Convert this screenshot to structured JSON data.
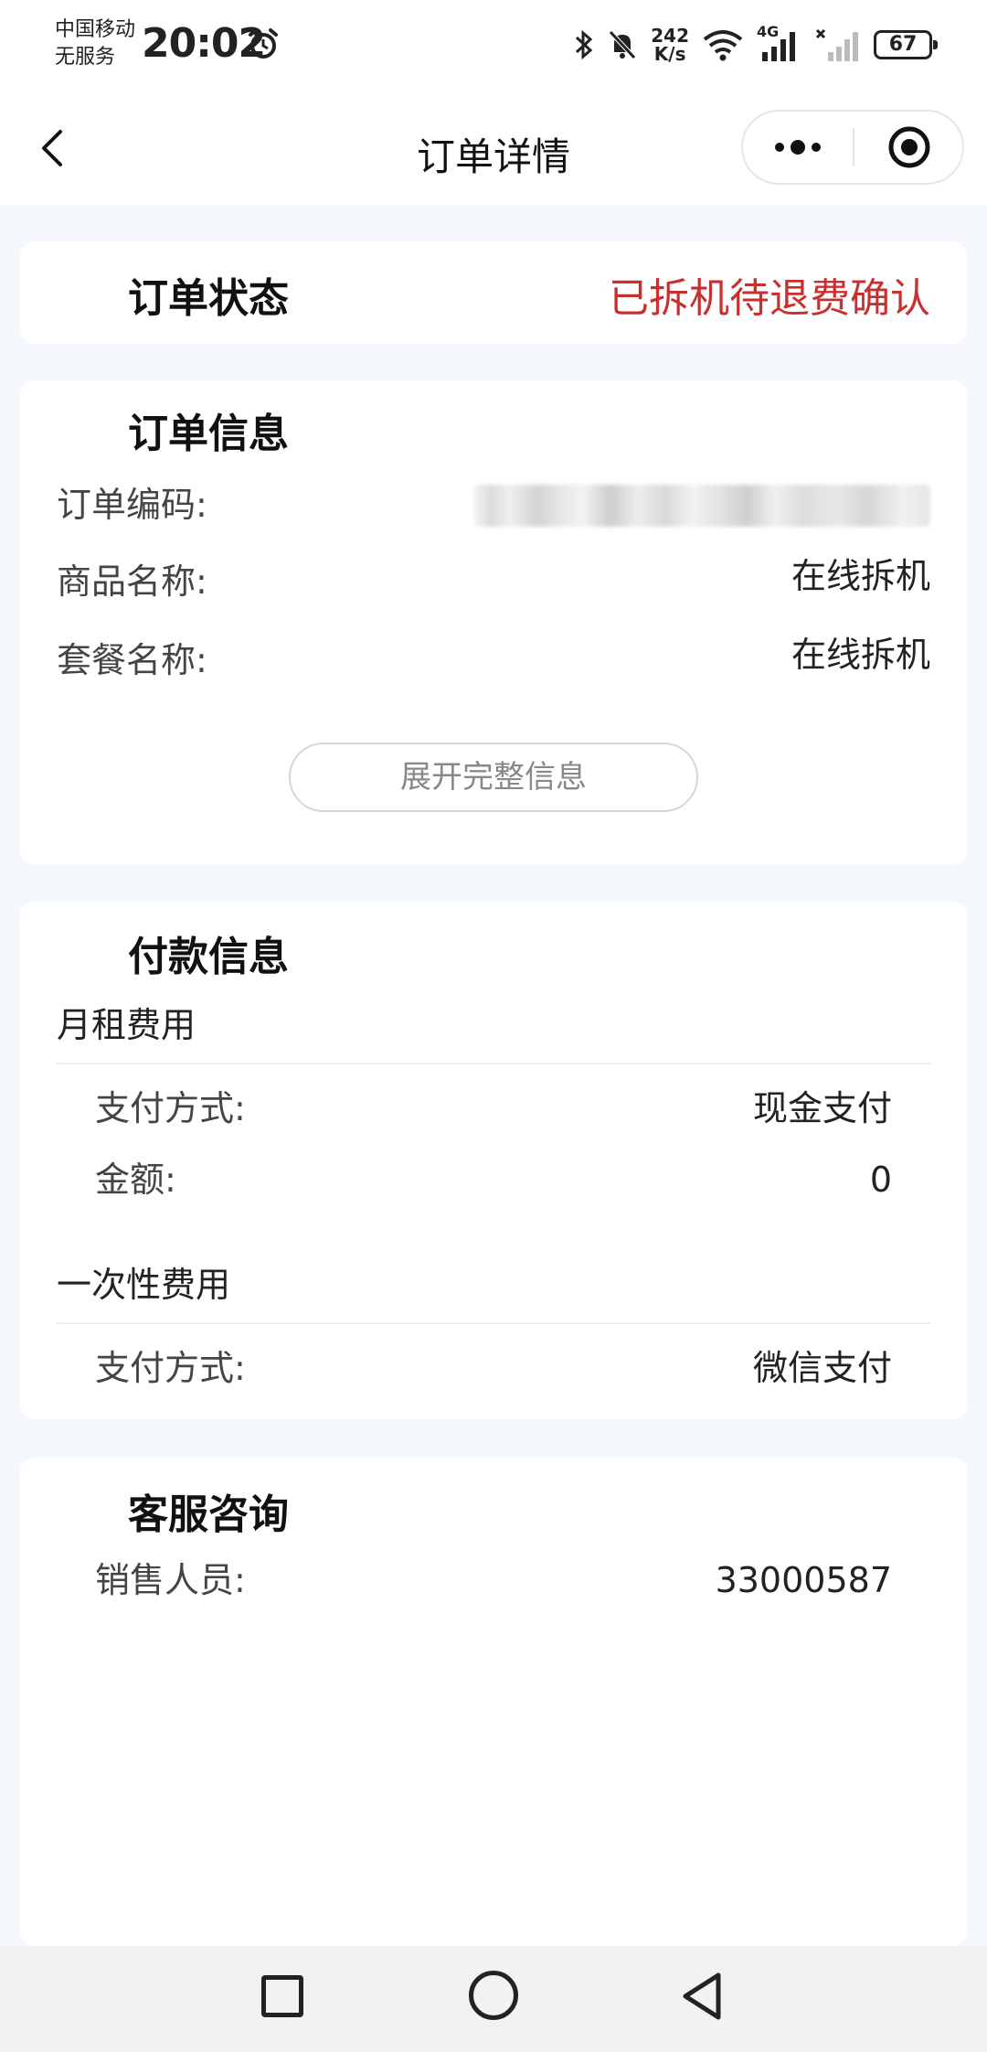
{
  "status_bar": {
    "carrier_line1": "中国移动",
    "carrier_line2": "无服务",
    "time": "20:02",
    "net_speed_value": "242",
    "net_speed_unit": "K/s",
    "network_type": "4G",
    "battery": "67"
  },
  "nav": {
    "title": "订单详情"
  },
  "order_status": {
    "label": "订单状态",
    "value": "已拆机待退费确认",
    "value_color": "#c8302f"
  },
  "order_info": {
    "title": "订单信息",
    "order_number_label": "订单编码:",
    "product_name_label": "商品名称:",
    "product_name_value": "在线拆机",
    "package_name_label": "套餐名称:",
    "package_name_value": "在线拆机",
    "expand_button": "展开完整信息"
  },
  "payment_info": {
    "title": "付款信息",
    "monthly": {
      "label": "月租费用",
      "method_label": "支付方式:",
      "method_value": "现金支付",
      "amount_label": "金额:",
      "amount_value": "0"
    },
    "one_time": {
      "label": "一次性费用",
      "method_label": "支付方式:",
      "method_value": "微信支付"
    }
  },
  "customer_service": {
    "title": "客服咨询",
    "sales_label": "销售人员:",
    "sales_value": "33000587"
  }
}
